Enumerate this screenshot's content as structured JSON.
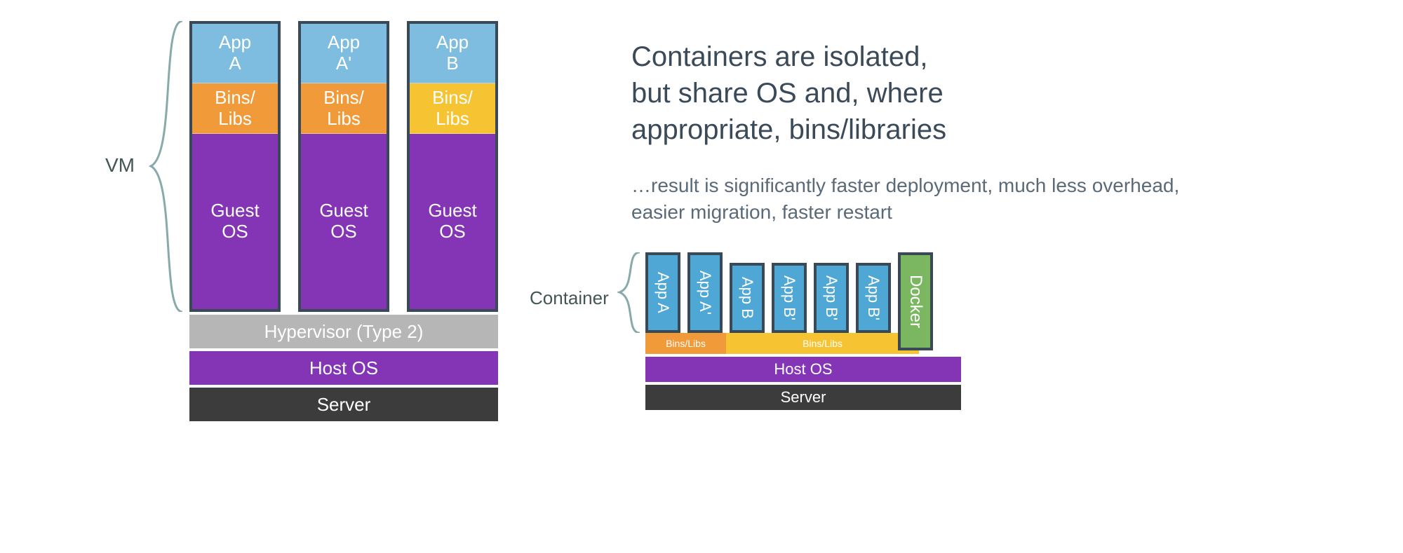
{
  "vm": {
    "label": "VM",
    "stacks": [
      {
        "app": "App\nA",
        "bins": "Bins/\nLibs",
        "binsColor": "orange",
        "guest": "Guest\nOS"
      },
      {
        "app": "App\nA'",
        "bins": "Bins/\nLibs",
        "binsColor": "orange",
        "guest": "Guest\nOS"
      },
      {
        "app": "App\nB",
        "bins": "Bins/\nLibs",
        "binsColor": "yellow",
        "guest": "Guest\nOS"
      }
    ],
    "base": {
      "hypervisor": "Hypervisor (Type 2)",
      "hostos": "Host OS",
      "server": "Server"
    }
  },
  "text": {
    "title_line1": "Containers are isolated,",
    "title_line2": "but share OS and, where",
    "title_line3": "appropriate, bins/libraries",
    "sub": "…result is significantly faster deployment, much less overhead, easier migration, faster restart"
  },
  "container": {
    "label": "Container",
    "apps": [
      "App A",
      "App A'",
      "App B",
      "App B'",
      "App B'",
      "App B'"
    ],
    "docker": "Docker",
    "bins_left": "Bins/Libs",
    "bins_right": "Bins/Libs",
    "base": {
      "hostos": "Host OS",
      "server": "Server"
    }
  }
}
